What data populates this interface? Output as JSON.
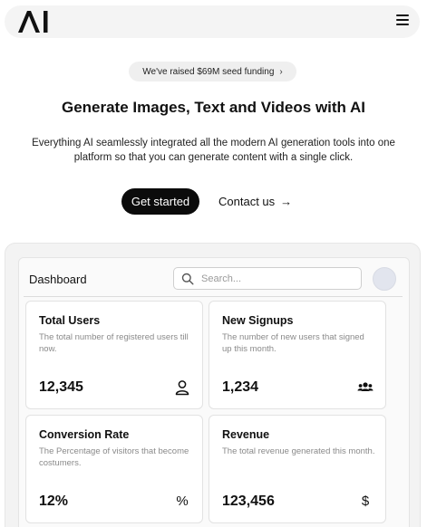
{
  "nav": {
    "logo_text": "AI",
    "menu_icon": "hamburger-menu-icon"
  },
  "announcement": {
    "text": "We've raised $69M seed funding",
    "chevron": "›"
  },
  "hero": {
    "title": "Generate Images, Text and Videos with AI",
    "description": "Everything AI seamlessly integrated all the modern AI generation tools into one platform so that you can generate content with a single click.",
    "primary_cta": "Get started",
    "secondary_cta": "Contact us",
    "secondary_arrow": "→"
  },
  "dashboard": {
    "title": "Dashboard",
    "search_placeholder": "Search...",
    "cards": [
      {
        "title": "Total Users",
        "description": "The total number of registered users till now.",
        "value": "12,345",
        "icon": "user-icon"
      },
      {
        "title": "New Signups",
        "description": "The number of new users that signed up this month.",
        "value": "1,234",
        "icon": "users-group-icon"
      },
      {
        "title": "Conversion Rate",
        "description": "The Percentage of visitors that become costumers.",
        "value": "12%",
        "icon_glyph": "%"
      },
      {
        "title": "Revenue",
        "description": "The total revenue generated this month.",
        "value": "123,456",
        "icon_glyph": "$"
      }
    ]
  }
}
